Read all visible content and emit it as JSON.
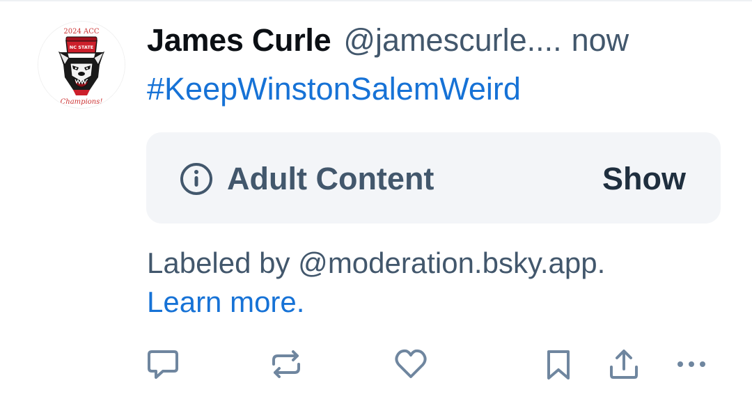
{
  "author": {
    "display_name": "James Curle",
    "handle": "@jamescurle....",
    "timestamp": "now",
    "avatar": {
      "icon": "nc-state-wolf-avatar",
      "top_text": "2024 ACC",
      "cap_text": "NC STATE",
      "bottom_text": "Champions!"
    }
  },
  "post": {
    "hashtag": "#KeepWinstonSalemWeird"
  },
  "content_warning": {
    "icon": "info-icon",
    "label": "Adult Content",
    "show_label": "Show"
  },
  "moderation": {
    "labeled_text": "Labeled by @moderation.bsky.app.",
    "learn_more": "Learn more."
  },
  "actions": [
    {
      "name": "reply",
      "icon": "reply-icon"
    },
    {
      "name": "repost",
      "icon": "repost-icon"
    },
    {
      "name": "like",
      "icon": "heart-icon"
    },
    {
      "name": "bookmark",
      "icon": "bookmark-icon"
    },
    {
      "name": "share",
      "icon": "share-icon"
    },
    {
      "name": "more",
      "icon": "more-options-icon"
    }
  ],
  "colors": {
    "link": "#1672d6",
    "muted": "#42576c",
    "text": "#0b0f14",
    "icon": "#6f869f",
    "warning_bg": "#f3f5f8"
  }
}
